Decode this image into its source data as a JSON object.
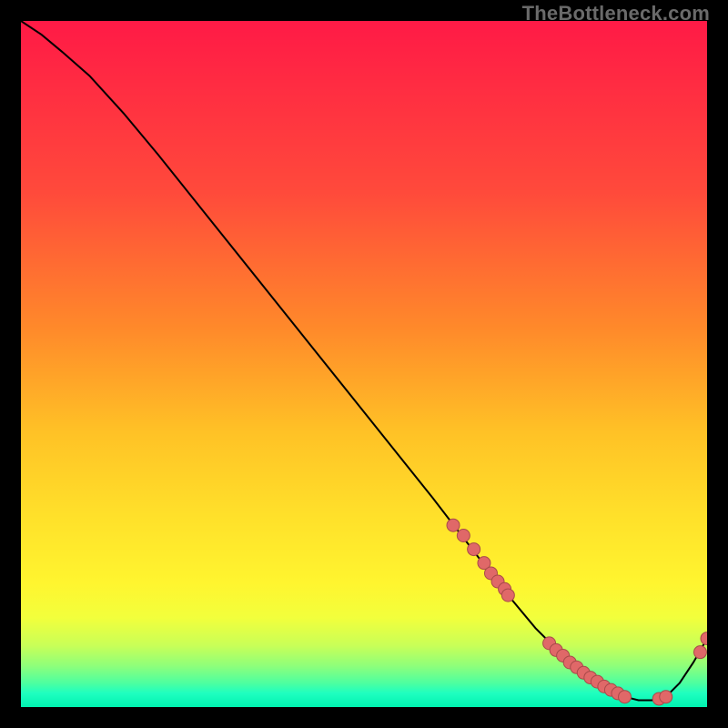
{
  "watermark": {
    "text": "TheBottleneck.com"
  },
  "colors": {
    "curve_stroke": "#000000",
    "dot_fill": "#e06868",
    "dot_stroke": "#a84a4a"
  },
  "chart_data": {
    "type": "line",
    "title": "",
    "xlabel": "",
    "ylabel": "",
    "xlim": [
      0,
      100
    ],
    "ylim": [
      0,
      100
    ],
    "series": [
      {
        "name": "bottleneck-curve",
        "x": [
          0,
          3,
          6,
          10,
          15,
          20,
          30,
          40,
          50,
          60,
          65,
          70,
          75,
          80,
          82,
          85,
          88,
          90,
          92,
          94,
          96,
          98,
          100
        ],
        "y": [
          100,
          98,
          95.5,
          92,
          86.5,
          80.5,
          68,
          55.5,
          43,
          30.5,
          24,
          17.5,
          11.5,
          6.5,
          5,
          3,
          1.5,
          1,
          1,
          1.5,
          3.5,
          6.5,
          10
        ]
      }
    ],
    "scatter_points": {
      "name": "highlighted-dots",
      "x": [
        63,
        64.5,
        66,
        67.5,
        68.5,
        69.5,
        70.5,
        71,
        77,
        78,
        79,
        80,
        81,
        82,
        83,
        84,
        85,
        86,
        87,
        88,
        93,
        94,
        99,
        100
      ],
      "y": [
        26.5,
        25,
        23,
        21,
        19.5,
        18.3,
        17.2,
        16.3,
        9.3,
        8.3,
        7.5,
        6.5,
        5.8,
        5,
        4.3,
        3.7,
        3,
        2.5,
        2,
        1.5,
        1.2,
        1.5,
        8,
        10
      ]
    }
  }
}
